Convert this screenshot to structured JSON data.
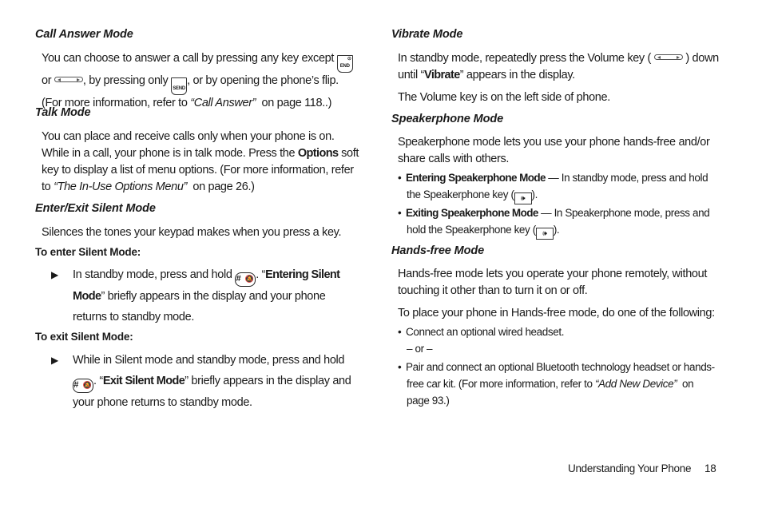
{
  "left": {
    "call_answer": {
      "heading": "Call Answer Mode",
      "line1_a": "You can choose to answer a call by pressing any key except",
      "end_key": "END",
      "line2_a": "or",
      "line2_b": ", by pressing only",
      "send_key": "SEND",
      "line2_c": ", or by opening the phone’s flip.",
      "line3_a": "(For more information, refer to",
      "line3_ref": "“Call Answer”",
      "line3_b": "on page 118..)"
    },
    "talk": {
      "heading": "Talk Mode",
      "line1": "You can place and receive calls only when your phone is on.",
      "line2_a": "While in a call, your phone is in talk mode. Press the",
      "line2_bold": "Options",
      "line2_b": "soft",
      "line3": "key to display a list of menu options. (For more information, refer",
      "line4_a": "to",
      "line4_ref": "“The In-Use Options Menu”",
      "line4_b": "on page 26.)"
    },
    "silent": {
      "heading": "Enter/Exit Silent Mode",
      "intro": "Silences the tones your keypad makes when you press a key.",
      "enter_sub": "To enter Silent Mode:",
      "enter_l1_a": "In standby mode, press and hold",
      "enter_l1_b": ". “",
      "enter_l1_bold": "Entering Silent",
      "enter_l2_bold": "Mode",
      "enter_l2_b": "” briefly appears in the display and your phone",
      "enter_l3": "returns to standby mode.",
      "exit_sub": "To exit Silent Mode:",
      "exit_l1": "While in Silent mode and standby mode, press and hold",
      "exit_l2_a": ". “",
      "exit_l2_bold": "Exit Silent Mode",
      "exit_l2_b": "” briefly appears in the display and",
      "exit_l3": "your phone returns to standby mode.",
      "bullet_glyph": "▶",
      "hash_key_glyph": "#"
    }
  },
  "right": {
    "vibrate": {
      "heading": "Vibrate Mode",
      "line1_a": "In standby mode, repeatedly press the Volume key (",
      "line1_b": ") down",
      "line2_a": "until “",
      "line2_bold": "Vibrate",
      "line2_b": "” appears in the display.",
      "line3": "The Volume key is on the left side of phone."
    },
    "speakerphone": {
      "heading": "Speakerphone Mode",
      "line1": "Speakerphone mode lets you use your phone hands-free and/or",
      "line2": "share calls with others.",
      "b1_bold": "Entering Speakerphone Mode",
      "b1_a": " — In standby mode, press and hold",
      "b1_l2_a": "the Speakerphone key (",
      "b1_l2_b": ").",
      "b2_bold": "Exiting Speakerphone Mode",
      "b2_a": " — In Speakerphone mode, press and",
      "b2_l2_a": "hold the Speakerphone key (",
      "b2_l2_b": ").",
      "bullet_glyph": "•"
    },
    "handsfree": {
      "heading": "Hands-free Mode",
      "line1": "Hands-free mode lets you operate your phone remotely, without",
      "line2": "touching it other than to turn it on or off.",
      "line3": "To place your phone in Hands-free mode, do one of the following:",
      "b1": "Connect an optional wired headset.",
      "or": "– or –",
      "b2_l1": "Pair and connect an optional Bluetooth technology headset or hands-",
      "b2_l2_a": "free car kit. (For more information, refer to",
      "b2_l2_ref": "“Add New Device”",
      "b2_l2_b": "on",
      "b2_l3": "page 93.)",
      "bullet_glyph": "•"
    }
  },
  "footer": {
    "section": "Understanding Your Phone",
    "page_number": "18"
  }
}
